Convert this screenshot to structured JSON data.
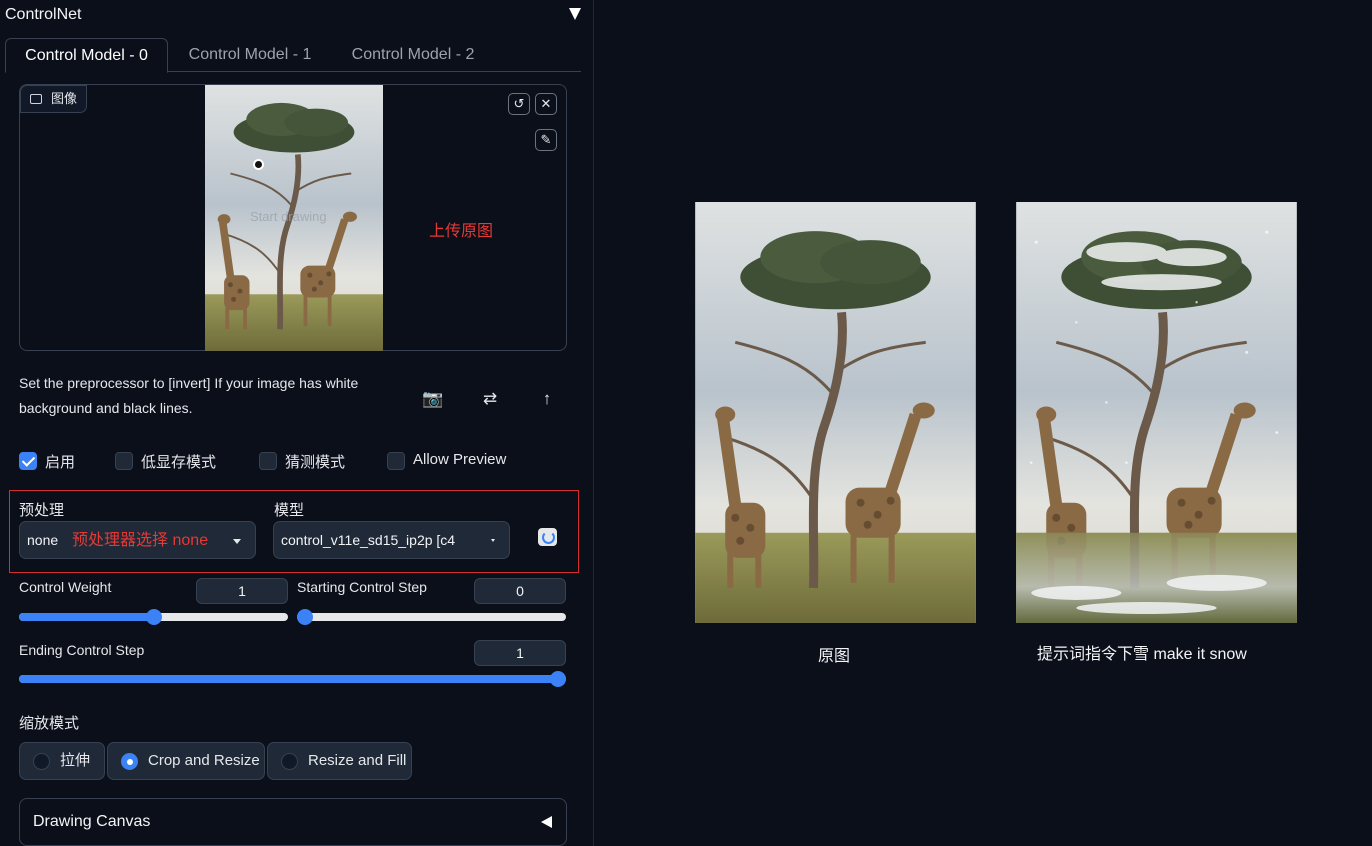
{
  "panel": {
    "title": "ControlNet"
  },
  "tabs": [
    {
      "label": "Control Model - 0",
      "active": true
    },
    {
      "label": "Control Model - 1",
      "active": false
    },
    {
      "label": "Control Model - 2",
      "active": false
    }
  ],
  "image_input": {
    "label": "图像",
    "label_icon": "image-icon",
    "start_drawing": "Start drawing",
    "upload_note": "上传原图",
    "buttons": [
      "undo-icon",
      "close-icon",
      "brush-icon"
    ]
  },
  "hint": "Set the preprocessor to [invert] If your image has white background and black lines.",
  "tools": [
    "camera-icon",
    "swap-icon",
    "upload-arrow-icon"
  ],
  "checkboxes": [
    {
      "label": "启用",
      "checked": true
    },
    {
      "label": "低显存模式",
      "checked": false
    },
    {
      "label": "猜测模式",
      "checked": false
    },
    {
      "label": "Allow Preview",
      "checked": false
    }
  ],
  "preprocessor": {
    "label": "预处理",
    "value": "none",
    "note": "预处理器选择 none"
  },
  "model": {
    "label": "模型",
    "value": "control_v11e_sd15_ip2p [c4"
  },
  "sliders": {
    "control_weight": {
      "label": "Control Weight",
      "value": "1",
      "fraction": 0.5
    },
    "starting_step": {
      "label": "Starting Control Step",
      "value": "0",
      "fraction": 0.0
    },
    "ending_step": {
      "label": "Ending Control Step",
      "value": "1",
      "fraction": 1.0
    }
  },
  "resize_mode": {
    "label": "缩放模式",
    "options": [
      {
        "label": "拉伸",
        "selected": false
      },
      {
        "label": "Crop and Resize",
        "selected": true
      },
      {
        "label": "Resize and Fill",
        "selected": false
      }
    ]
  },
  "drawing_canvas": {
    "label": "Drawing Canvas"
  },
  "comparison": {
    "original_caption": "原图",
    "result_caption": "提示词指令下雪 make it snow"
  },
  "colors": {
    "background": "#0b0f19",
    "accent": "#3b82f6",
    "annotation_red": "#e53935"
  }
}
